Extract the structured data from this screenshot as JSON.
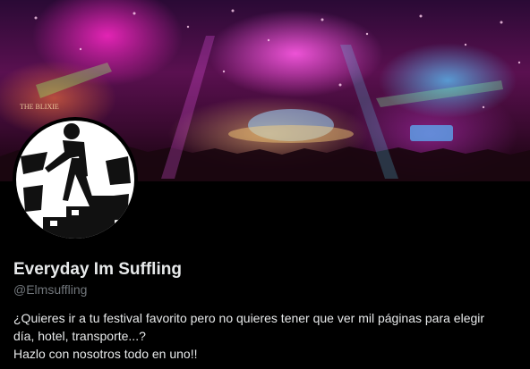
{
  "profile": {
    "display_name": "Everyday Im Suffling",
    "handle": "@Elmsuffling",
    "bio_lines": [
      "¿Quieres ir a tu festival favorito pero no quieres tener que ver mil páginas para elegir",
      "día, hotel, transporte...?",
      "Hazlo con nosotros todo en uno!!"
    ],
    "banner_sign_text": "THE BLIXIE",
    "avatar_icon": "person-walking-icon"
  },
  "colors": {
    "background": "#000000",
    "text_primary": "#e7e9ea",
    "text_secondary": "#71767b"
  }
}
